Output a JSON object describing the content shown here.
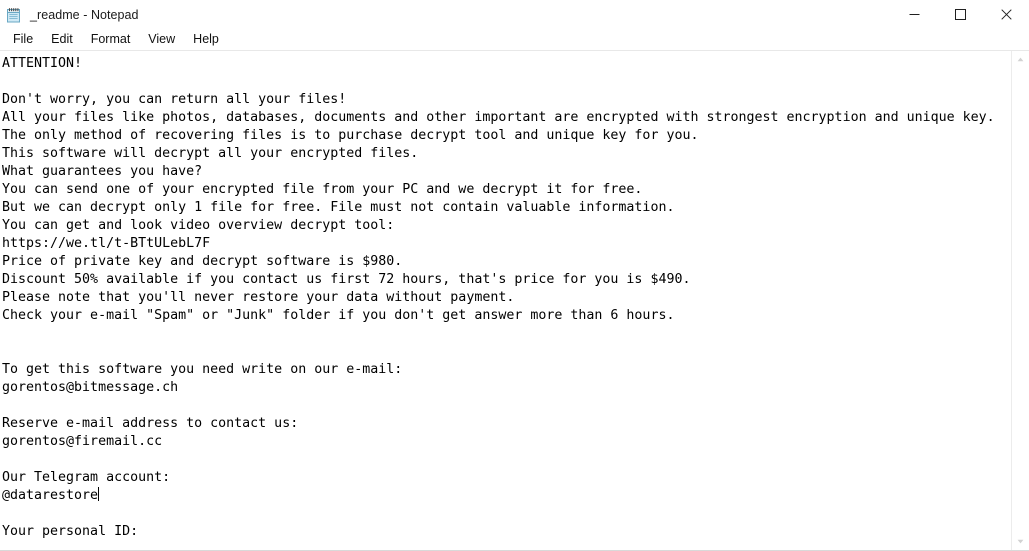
{
  "window": {
    "title": "_readme - Notepad",
    "icon": "notepad-icon",
    "controls": {
      "minimize": "Minimize",
      "maximize": "Maximize",
      "close": "Close"
    }
  },
  "menubar": {
    "items": [
      {
        "label": "File"
      },
      {
        "label": "Edit"
      },
      {
        "label": "Format"
      },
      {
        "label": "View"
      },
      {
        "label": "Help"
      }
    ]
  },
  "document": {
    "filename": "_readme",
    "caret_after_line": 24,
    "lines": [
      "ATTENTION!",
      "",
      "Don't worry, you can return all your files!",
      "All your files like photos, databases, documents and other important are encrypted with strongest encryption and unique key.",
      "The only method of recovering files is to purchase decrypt tool and unique key for you.",
      "This software will decrypt all your encrypted files.",
      "What guarantees you have?",
      "You can send one of your encrypted file from your PC and we decrypt it for free.",
      "But we can decrypt only 1 file for free. File must not contain valuable information.",
      "You can get and look video overview decrypt tool:",
      "https://we.tl/t-BTtULebL7F",
      "Price of private key and decrypt software is $980.",
      "Discount 50% available if you contact us first 72 hours, that's price for you is $490.",
      "Please note that you'll never restore your data without payment.",
      "Check your e-mail \"Spam\" or \"Junk\" folder if you don't get answer more than 6 hours.",
      "",
      "",
      "To get this software you need write on our e-mail:",
      "gorentos@bitmessage.ch",
      "",
      "Reserve e-mail address to contact us:",
      "gorentos@firemail.cc",
      "",
      "Our Telegram account:",
      "@datarestore",
      "",
      "Your personal ID:"
    ],
    "details": {
      "video_url": "https://we.tl/t-BTtULebL7F",
      "price": "$980",
      "discount_price": "$490",
      "discount_percent": "50%",
      "discount_window": "72 hours",
      "response_time": "6 hours",
      "primary_email": "gorentos@bitmessage.ch",
      "reserve_email": "gorentos@firemail.cc",
      "telegram": "@datarestore",
      "free_files": "1 file"
    }
  },
  "scrollbar": {
    "up_arrow": "scroll-up-icon",
    "down_arrow": "scroll-down-icon"
  },
  "colors": {
    "window_bg": "#ffffff",
    "text": "#000000",
    "menu_text": "#101010",
    "border": "#e8e8e8",
    "icon_blue": "#9fd3ea"
  }
}
